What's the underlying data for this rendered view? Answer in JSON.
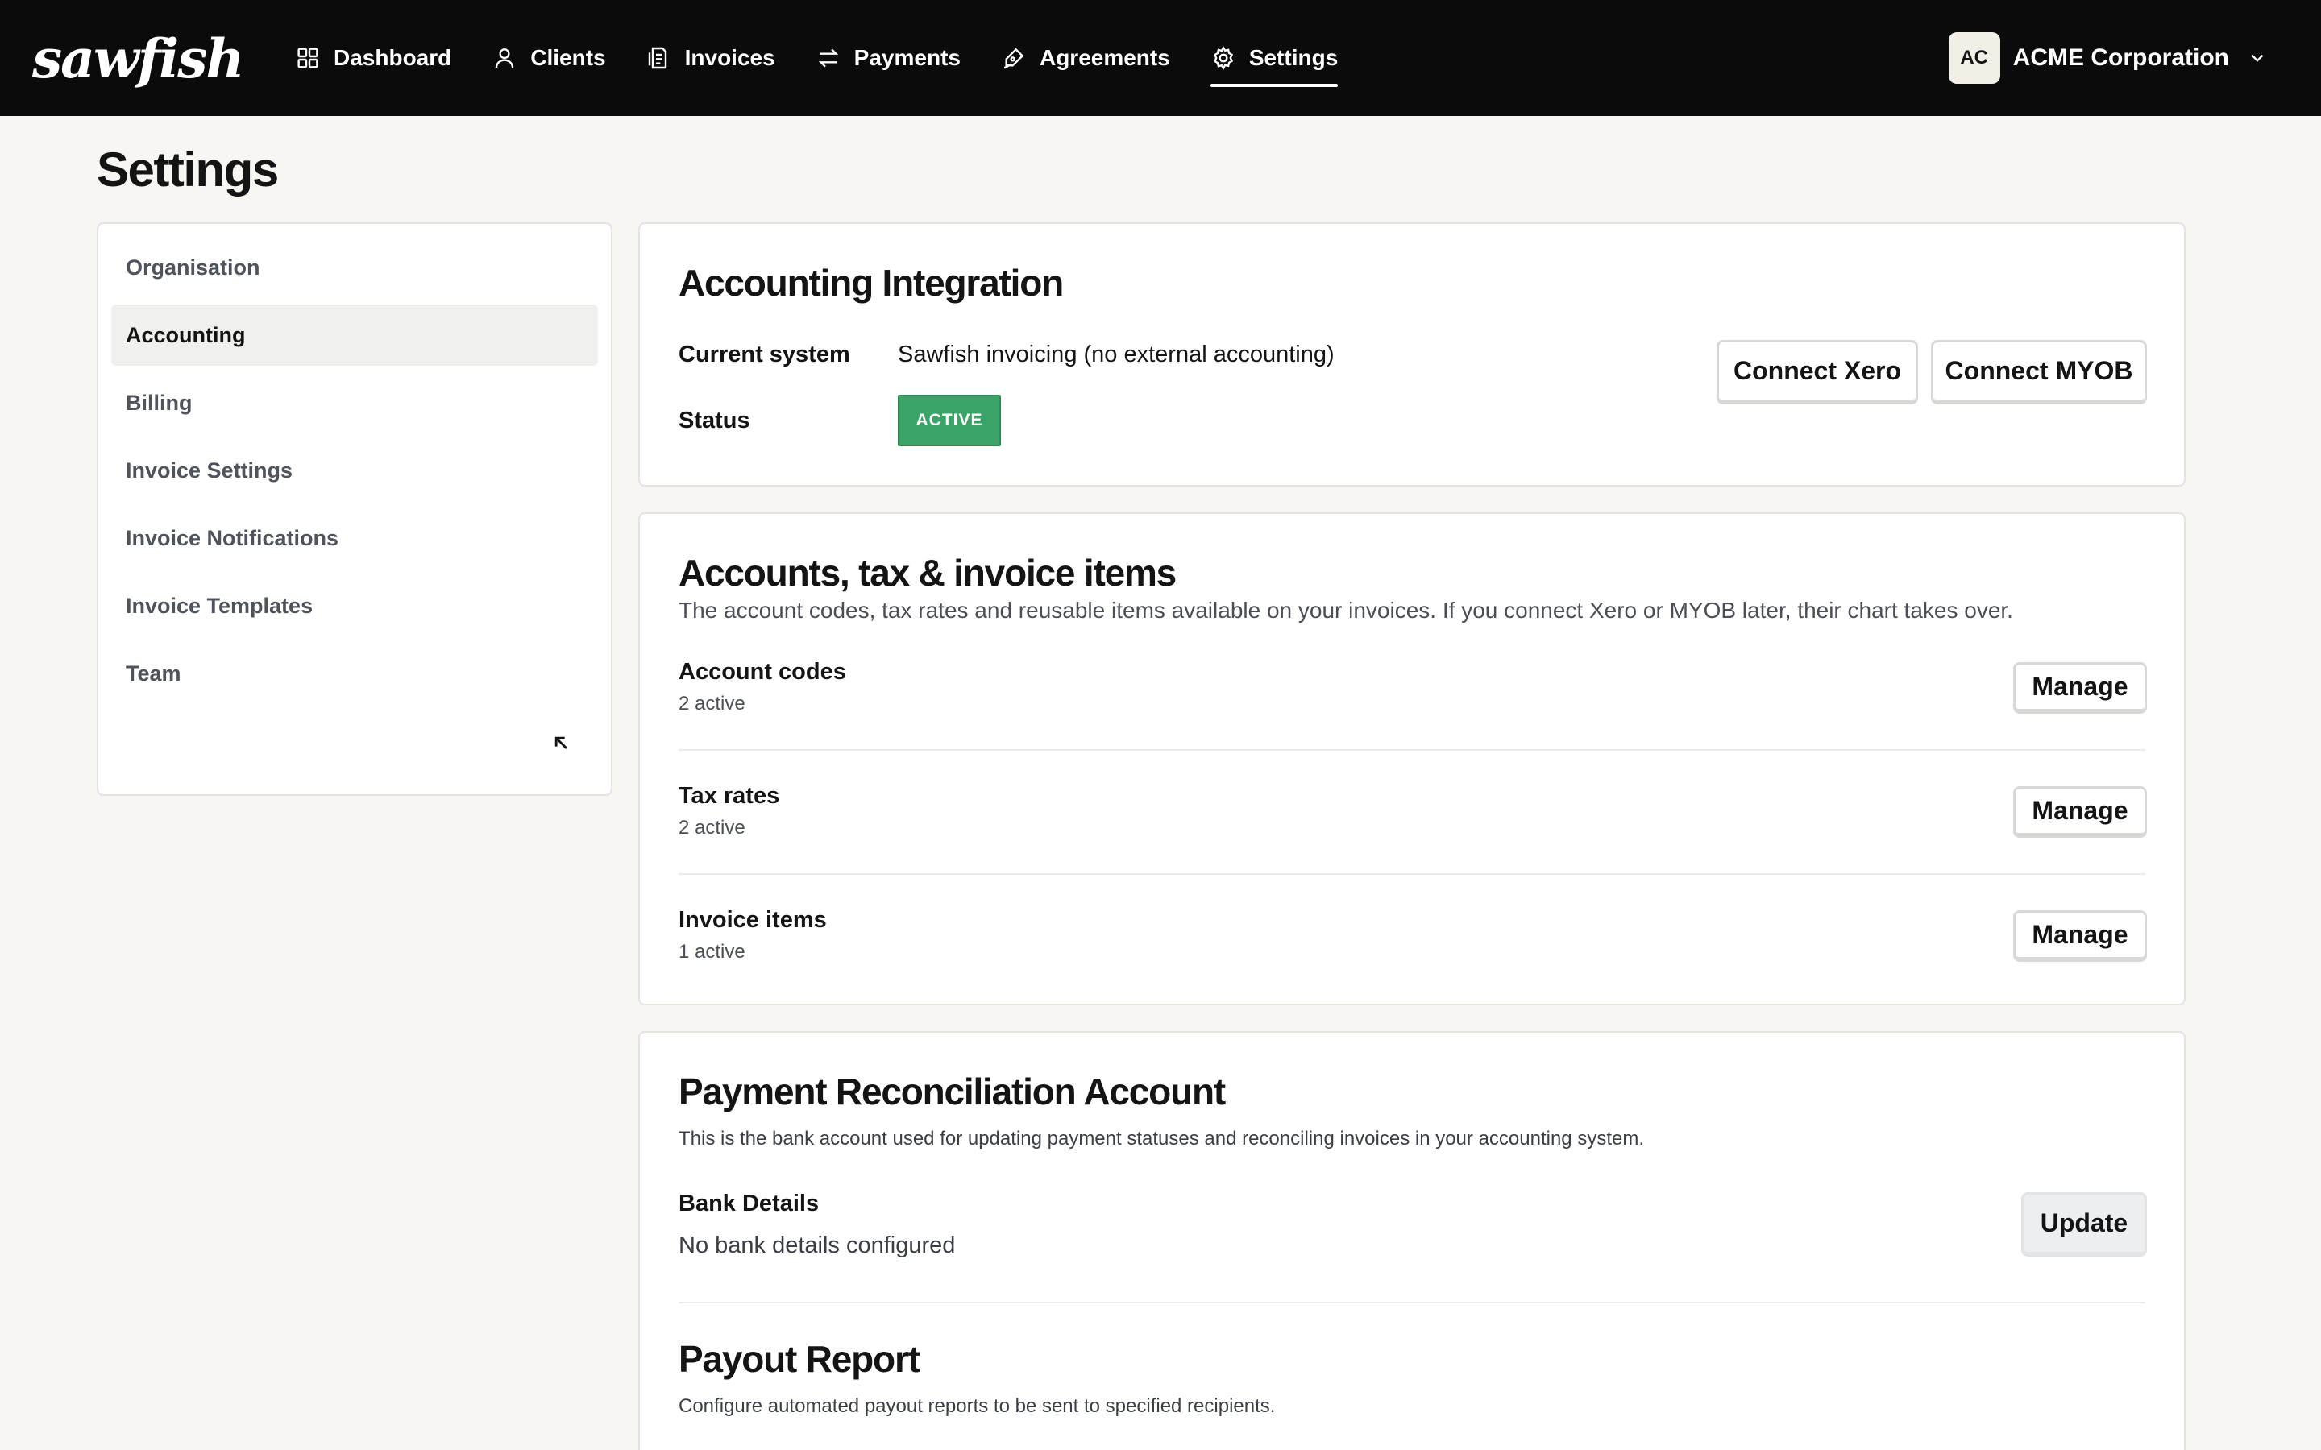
{
  "app": {
    "logo_text": "sawfish"
  },
  "nav": {
    "items": [
      {
        "label": "Dashboard",
        "icon": "grid-icon"
      },
      {
        "label": "Clients",
        "icon": "user-icon"
      },
      {
        "label": "Invoices",
        "icon": "invoice-icon"
      },
      {
        "label": "Payments",
        "icon": "transfer-arrows-icon"
      },
      {
        "label": "Agreements",
        "icon": "pen-signature-icon"
      },
      {
        "label": "Settings",
        "icon": "gear-icon",
        "active": true
      }
    ]
  },
  "org": {
    "initials": "AC",
    "name": "ACME Corporation"
  },
  "page": {
    "title": "Settings"
  },
  "sidebar": {
    "items": [
      {
        "label": "Organisation"
      },
      {
        "label": "Accounting",
        "active": true
      },
      {
        "label": "Billing"
      },
      {
        "label": "Invoice Settings"
      },
      {
        "label": "Invoice Notifications"
      },
      {
        "label": "Invoice Templates"
      },
      {
        "label": "Team"
      }
    ]
  },
  "integration": {
    "title": "Accounting Integration",
    "current_system_label": "Current system",
    "current_system_value": "Sawfish invoicing (no external accounting)",
    "status_label": "Status",
    "status_badge": "ACTIVE",
    "connect_xero": "Connect Xero",
    "connect_myob": "Connect MYOB"
  },
  "accounts": {
    "title": "Accounts, tax & invoice items",
    "description": "The account codes, tax rates and reusable items available on your invoices. If you connect Xero or MYOB later, their chart takes over.",
    "rows": [
      {
        "title": "Account codes",
        "sub": "2 active",
        "button": "Manage"
      },
      {
        "title": "Tax rates",
        "sub": "2 active",
        "button": "Manage"
      },
      {
        "title": "Invoice items",
        "sub": "1 active",
        "button": "Manage"
      }
    ]
  },
  "reconciliation": {
    "title": "Payment Reconciliation Account",
    "description": "This is the bank account used for updating payment statuses and reconciling invoices in your accounting system.",
    "bank_label": "Bank Details",
    "bank_value": "No bank details configured",
    "update_button": "Update"
  },
  "payout": {
    "title": "Payout Report",
    "description": "Configure automated payout reports to be sent to specified recipients."
  },
  "colors": {
    "topbar": "#0b0b0b",
    "page_bg": "#f7f6f2",
    "active_badge": "#3aa367"
  }
}
